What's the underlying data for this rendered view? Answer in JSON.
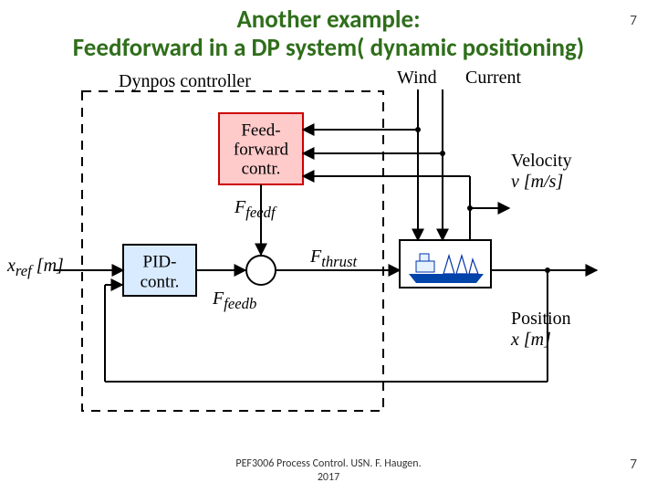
{
  "title_line1": "Another example:",
  "title_line2": "Feedforward in a DP system( dynamic positioning)",
  "page_number": "7",
  "footer_line1": "PEF3006 Process Control. USN. F. Haugen.",
  "footer_line2": "2017",
  "diagram": {
    "outer_label": "Dynpos controller",
    "input_label_html": "x<sub>ref</sub> [m]",
    "pid": {
      "line1": "PID-",
      "line2": "contr."
    },
    "ff": {
      "line1": "Feed-",
      "line2": "forward",
      "line3": "contr."
    },
    "signals": {
      "F_feedb_html": "F<sub>feedb</sub>",
      "F_feedf_html": "F<sub>feedf</sub>",
      "F_thrust_html": "F<sub>thrust</sub>"
    },
    "disturbances": {
      "wind": "Wind",
      "current": "Current"
    },
    "outputs": {
      "velocity_line1": "Velocity",
      "velocity_line2_html": "v [m/s]",
      "position_line1": "Position",
      "position_line2_html": "x [m]"
    }
  },
  "colors": {
    "pid_fill": "#d9ebff",
    "ff_fill": "#ffcaca",
    "ff_stroke": "#cc0000",
    "ship_fill": "#e6f2ff",
    "ship_stroke": "#0033aa",
    "title": "#2f6e1b"
  }
}
